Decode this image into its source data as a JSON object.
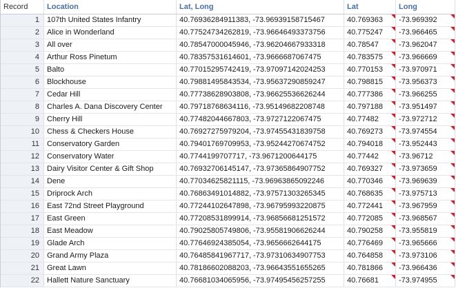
{
  "columns": {
    "record": "Record",
    "location": "Location",
    "latlong": "Lat, Long",
    "lat": "Lat",
    "long": "Long"
  },
  "colors": {
    "header_accent": "#4a6fa5",
    "flag": "#d0202a",
    "record_bg": "#eef1f6"
  },
  "rows": [
    {
      "record": "1",
      "location": "107th United States Infantry",
      "latlong": "40.76936284911383, -73.96939158715467",
      "lat": "40.769363",
      "long": "-73.969392"
    },
    {
      "record": "2",
      "location": "Alice in Wonderland",
      "latlong": "40.77524734262819, -73.96646493373756",
      "lat": "40.775247",
      "long": "-73.966465"
    },
    {
      "record": "3",
      "location": "All over",
      "latlong": "40.78547000045946, -73.96204667933318",
      "lat": "40.78547",
      "long": "-73.962047"
    },
    {
      "record": "4",
      "location": "Arthur Ross Pinetum",
      "latlong": "40.78357531614601, -73.9666687067475",
      "lat": "40.783575",
      "long": "-73.966669"
    },
    {
      "record": "5",
      "location": "Balto",
      "latlong": "40.77015295742419, -73.97097142024253",
      "lat": "40.770153",
      "long": "-73.970971"
    },
    {
      "record": "6",
      "location": "Blockhouse",
      "latlong": "40.79881495843534, -73.95637290859247",
      "lat": "40.798815",
      "long": "-73.956373"
    },
    {
      "record": "7",
      "location": "Cedar Hill",
      "latlong": "40.77738628903808, -73.96625536626244",
      "lat": "40.777386",
      "long": "-73.966255"
    },
    {
      "record": "8",
      "location": "Charles A. Dana Discovery Center",
      "latlong": "40.79718768634116, -73.95149682208748",
      "lat": "40.797188",
      "long": "-73.951497"
    },
    {
      "record": "9",
      "location": "Cherry Hill",
      "latlong": "40.77482044667803, -73.9727122067475",
      "lat": "40.77482",
      "long": "-73.972712"
    },
    {
      "record": "10",
      "location": "Chess & Checkers House",
      "latlong": "40.76927275979204, -73.97455431839758",
      "lat": "40.769273",
      "long": "-73.974554"
    },
    {
      "record": "11",
      "location": "Conservatory Garden",
      "latlong": "40.79401769709953, -73.95244270674752",
      "lat": "40.794018",
      "long": "-73.952443"
    },
    {
      "record": "12",
      "location": "Conservatory Water",
      "latlong": "40.7744199707717, -73.9671200644175",
      "lat": "40.77442",
      "long": "-73.96712"
    },
    {
      "record": "13",
      "location": "Dairy Visitor Center & Gift Shop",
      "latlong": "40.76932706145147, -73.97365864907752",
      "lat": "40.769327",
      "long": "-73.973659"
    },
    {
      "record": "14",
      "location": "Dene",
      "latlong": "40.77034625821115, -73.96963865092246",
      "lat": "40.770346",
      "long": "-73.969639"
    },
    {
      "record": "15",
      "location": "Driprock Arch",
      "latlong": "40.76863491014882, -73.97571303265345",
      "lat": "40.768635",
      "long": "-73.975713"
    },
    {
      "record": "16",
      "location": "East 72nd Street Playground",
      "latlong": "40.77244102647898, -73.96795993220875",
      "lat": "40.772441",
      "long": "-73.967959"
    },
    {
      "record": "17",
      "location": "East Green",
      "latlong": "40.77208531899914, -73.96856681251572",
      "lat": "40.772085",
      "long": "-73.968567"
    },
    {
      "record": "18",
      "location": "East Meadow",
      "latlong": "40.79025805749806, -73.95581906626244",
      "lat": "40.790258",
      "long": "-73.955819"
    },
    {
      "record": "19",
      "location": "Glade Arch",
      "latlong": "40.77646924385054, -73.9656662644175",
      "lat": "40.776469",
      "long": "-73.965666"
    },
    {
      "record": "20",
      "location": "Grand Army Plaza",
      "latlong": "40.76485841967717, -73.97310634907753",
      "lat": "40.764858",
      "long": "-73.973106"
    },
    {
      "record": "21",
      "location": "Great Lawn",
      "latlong": "40.78186602088203, -73.96643551655265",
      "lat": "40.781866",
      "long": "-73.966436"
    },
    {
      "record": "22",
      "location": "Hallett Nature Sanctuary",
      "latlong": "40.76681034065956, -73.97495456257255",
      "lat": "40.76681",
      "long": "-73.974955"
    }
  ]
}
